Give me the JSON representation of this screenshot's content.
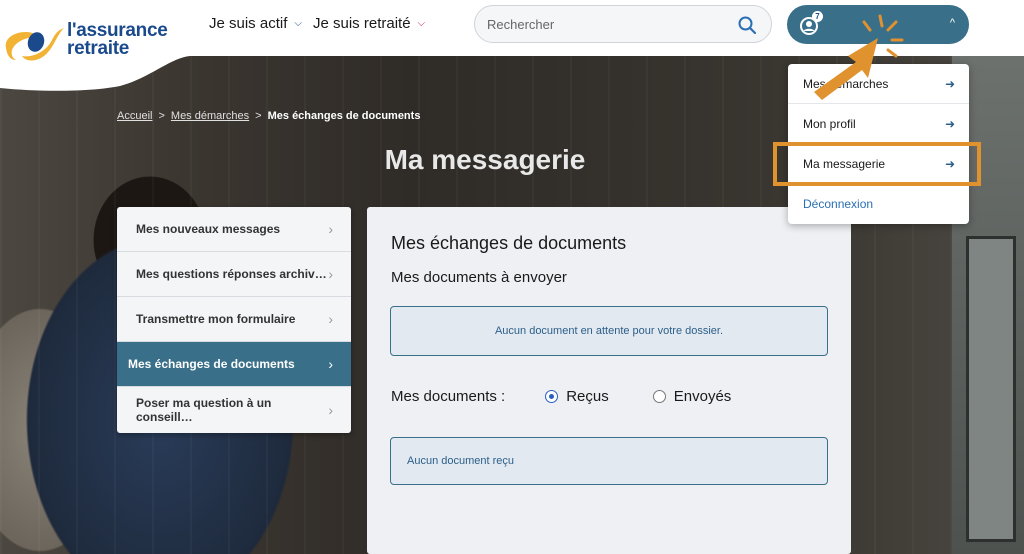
{
  "brand": {
    "line1": "l'assurance",
    "line2": "retraite"
  },
  "nav": [
    {
      "label": "Je suis actif"
    },
    {
      "label": "Je suis retraité"
    }
  ],
  "search": {
    "placeholder": "Rechercher"
  },
  "account": {
    "badge_count": "7"
  },
  "breadcrumb": {
    "home": "Accueil",
    "demarches": "Mes démarches",
    "current": "Mes échanges de documents",
    "sep": ">"
  },
  "page": {
    "title": "Ma messagerie"
  },
  "side_menu": [
    {
      "label": "Mes nouveaux messages",
      "active": false
    },
    {
      "label": "Mes questions réponses archiv…",
      "active": false
    },
    {
      "label": "Transmettre mon formulaire",
      "active": false
    },
    {
      "label": "Mes échanges de documents",
      "active": true
    },
    {
      "label": "Poser ma question à un conseill…",
      "active": false
    }
  ],
  "panel": {
    "title": "Mes échanges de documents",
    "subtitle": "Mes documents à envoyer",
    "pending_empty": "Aucun document en attente pour votre dossier.",
    "docs_label": "Mes documents :",
    "radio_received": "Reçus",
    "radio_sent": "Envoyés",
    "received_empty": "Aucun document reçu"
  },
  "dropdown": [
    {
      "label": "Mes démarches"
    },
    {
      "label": "Mon profil"
    },
    {
      "label": "Ma messagerie"
    },
    {
      "label": "Déconnexion"
    }
  ],
  "colors": {
    "brand_blue": "#1b4a8c",
    "accent_teal": "#3a6f8a",
    "logo_yellow": "#f2b233",
    "highlight_orange": "#e0922f"
  },
  "icons": {
    "search": "search-icon",
    "account": "user-circle-icon",
    "chevron": "chevron-down-icon",
    "arrow": "arrow-right-icon"
  }
}
